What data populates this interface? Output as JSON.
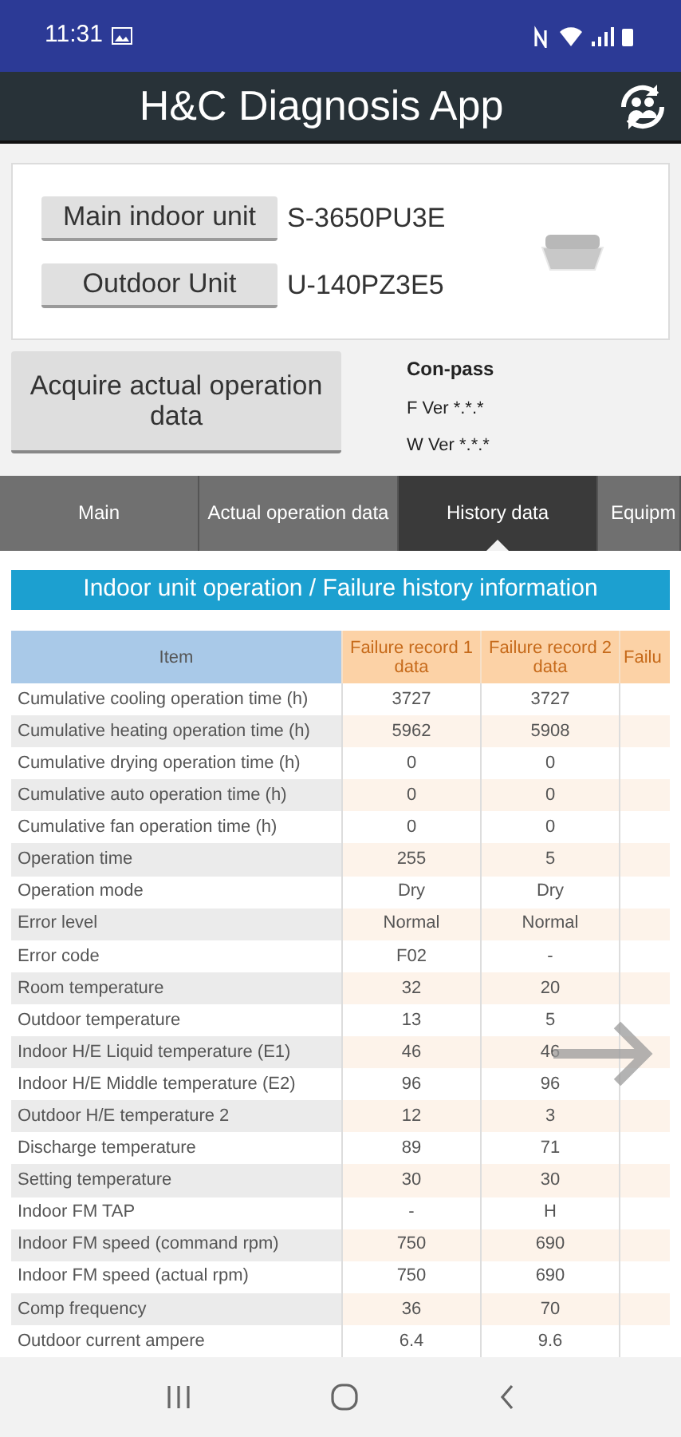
{
  "status_bar": {
    "time": "11:31"
  },
  "app_bar": {
    "title": "H&C Diagnosis App"
  },
  "units": [
    {
      "button": "Main indoor unit",
      "model": "S-3650PU3E"
    },
    {
      "button": "Outdoor Unit",
      "model": "U-140PZ3E5"
    }
  ],
  "acquire_button": "Acquire actual operation data",
  "con_pass": {
    "title": "Con-pass",
    "f_ver": "F Ver *.*.*",
    "w_ver": "W Ver *.*.*"
  },
  "tabs": [
    {
      "label": "Main",
      "selected": false
    },
    {
      "label": "Actual operation data",
      "selected": false
    },
    {
      "label": "History data",
      "selected": true
    },
    {
      "label": "Equipm",
      "selected": false
    }
  ],
  "section_title": "Indoor unit operation / Failure history information",
  "table": {
    "columns": [
      "Item",
      "Failure record 1 data",
      "Failure record 2 data",
      "Failu"
    ],
    "rows": [
      [
        "Cumulative cooling operation time (h)",
        "3727",
        "3727"
      ],
      [
        "Cumulative heating operation time (h)",
        "5962",
        "5908"
      ],
      [
        "Cumulative drying operation time (h)",
        "0",
        "0"
      ],
      [
        "Cumulative auto operation time (h)",
        "0",
        "0"
      ],
      [
        "Cumulative fan operation time (h)",
        "0",
        "0"
      ],
      [
        "Operation time",
        "255",
        "5"
      ],
      [
        "Operation mode",
        "Dry",
        "Dry"
      ],
      [
        "Error level",
        "Normal",
        "Normal"
      ],
      [
        "Error code",
        "F02",
        "-"
      ],
      [
        "Room temperature",
        "32",
        "20"
      ],
      [
        "Outdoor temperature",
        "13",
        "5"
      ],
      [
        "Indoor H/E Liquid temperature (E1)",
        "46",
        "46"
      ],
      [
        "Indoor H/E Middle temperature (E2)",
        "96",
        "96"
      ],
      [
        "Outdoor H/E temperature 2",
        "12",
        "3"
      ],
      [
        "Discharge temperature",
        "89",
        "71"
      ],
      [
        "Setting temperature",
        "30",
        "30"
      ],
      [
        "Indoor FM TAP",
        "-",
        "H"
      ],
      [
        "Indoor FM speed (command rpm)",
        "750",
        "690"
      ],
      [
        "Indoor FM speed (actual rpm)",
        "750",
        "690"
      ],
      [
        "Comp frequency",
        "36",
        "70"
      ],
      [
        "Outdoor current ampere",
        "6.4",
        "9.6"
      ]
    ]
  }
}
